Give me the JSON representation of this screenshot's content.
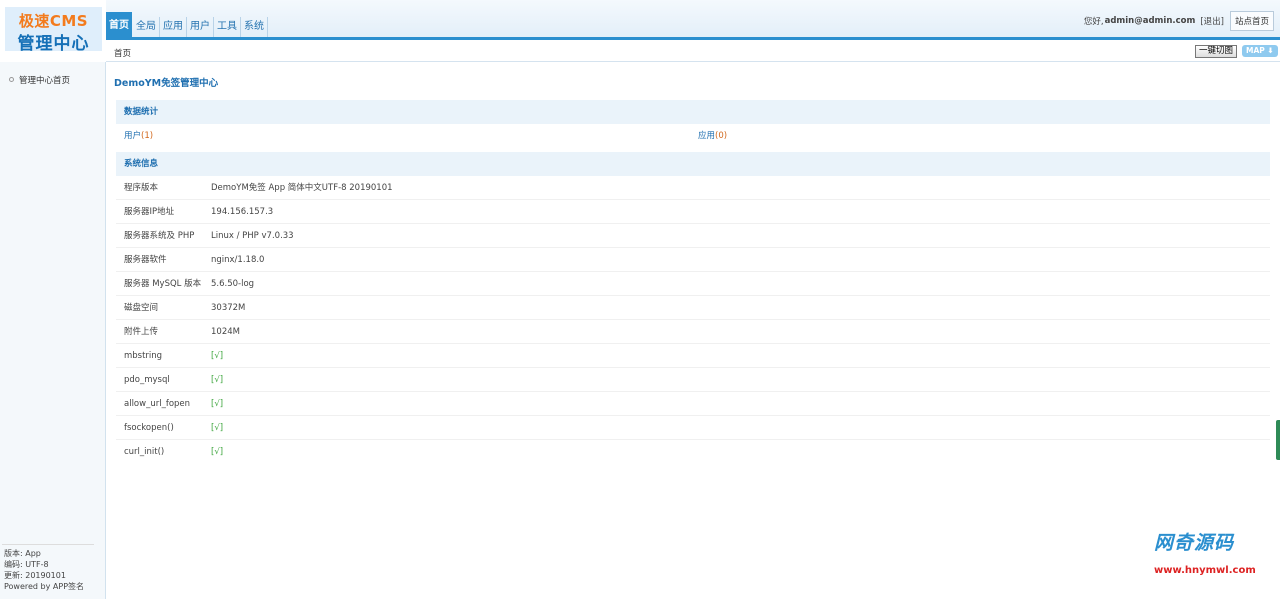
{
  "logo": {
    "line1": "极速CMS",
    "line2": "管理中心"
  },
  "nav": {
    "tabs": [
      "首页",
      "全局",
      "应用",
      "用户",
      "工具",
      "系统"
    ],
    "active_index": 0
  },
  "userbar": {
    "greeting": "您好,",
    "email": "admin@admin.com",
    "logout": "[退出]",
    "home": "站点首页"
  },
  "breadcrumb": "首页",
  "toolbar": {
    "cache_button": "一键切图",
    "map_button": "MAP ⬇"
  },
  "sidebar": {
    "menu_item": "管理中心首页",
    "info": [
      "版本: App",
      "编码: UTF-8",
      "更新: 20190101",
      "Powered by APP签名"
    ]
  },
  "main": {
    "title": "DemoYM免签管理中心",
    "stats_header": "数据统计",
    "stats": [
      {
        "label": "用户",
        "count": "(1)"
      },
      {
        "label": "应用",
        "count": "(0)"
      }
    ],
    "sysinfo_header": "系统信息",
    "sysinfo": [
      {
        "key": "程序版本",
        "value": "DemoYM免签 App 简体中文UTF-8 20190101"
      },
      {
        "key": "服务器IP地址",
        "value": "194.156.157.3"
      },
      {
        "key": "服务器系统及 PHP",
        "value": "Linux / PHP v7.0.33"
      },
      {
        "key": "服务器软件",
        "value": "nginx/1.18.0"
      },
      {
        "key": "服务器 MySQL 版本",
        "value": "5.6.50-log"
      },
      {
        "key": "磁盘空间",
        "value": "30372M"
      },
      {
        "key": "附件上传",
        "value": "1024M"
      },
      {
        "key": "mbstring",
        "value": "[√]"
      },
      {
        "key": "pdo_mysql",
        "value": "[√]"
      },
      {
        "key": "allow_url_fopen",
        "value": "[√]"
      },
      {
        "key": "fsockopen()",
        "value": "[√]"
      },
      {
        "key": "curl_init()",
        "value": "[√]"
      }
    ]
  },
  "watermark": {
    "name": "网奇源码",
    "url": "www.hnymwl.com"
  },
  "colors": {
    "accent": "#2b8fcf",
    "link": "#1f6fb0",
    "ok": "#3aa43a",
    "count": "#d2691e"
  }
}
